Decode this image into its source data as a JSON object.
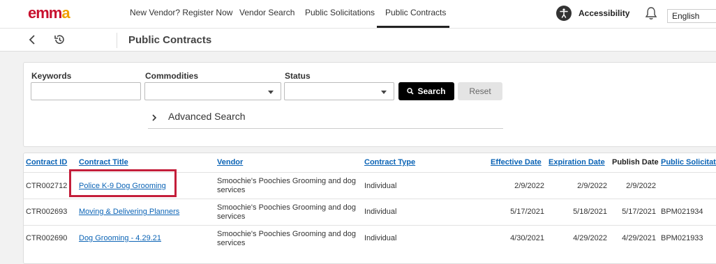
{
  "header": {
    "logo_text": "emma",
    "nav": [
      {
        "label": "New Vendor? Register Now",
        "active": false
      },
      {
        "label": "Vendor Search",
        "active": false
      },
      {
        "label": "Public Solicitations",
        "active": false
      },
      {
        "label": "Public Contracts",
        "active": true
      }
    ],
    "accessibility_label": "Accessibility",
    "language": "English"
  },
  "subheader": {
    "title": "Public Contracts"
  },
  "search": {
    "keywords_label": "Keywords",
    "keywords_value": "",
    "commodities_label": "Commodities",
    "status_label": "Status",
    "search_button": "Search",
    "reset_button": "Reset",
    "advanced_label": "Advanced Search"
  },
  "table": {
    "columns": [
      "Contract ID",
      "Contract Title",
      "Vendor",
      "Contract Type",
      "Effective Date",
      "Expiration Date",
      "Publish Date",
      "Public Solicitati"
    ],
    "rows": [
      {
        "id": "CTR002712",
        "title": "Police K-9 Dog Grooming",
        "vendor": "Smoochie's Poochies Grooming and dog services",
        "type": "Individual",
        "effective": "2/9/2022",
        "expiration": "2/9/2022",
        "publish": "2/9/2022",
        "solicitation": ""
      },
      {
        "id": "CTR002693",
        "title": "Moving & Delivering Planners",
        "vendor": "Smoochie's Poochies Grooming and dog services",
        "type": "Individual",
        "effective": "5/17/2021",
        "expiration": "5/18/2021",
        "publish": "5/17/2021",
        "solicitation": "BPM021934"
      },
      {
        "id": "CTR002690",
        "title": "Dog Grooming - 4.29.21",
        "vendor": "Smoochie's Poochies Grooming and dog services",
        "type": "Individual",
        "effective": "4/30/2021",
        "expiration": "4/29/2022",
        "publish": "4/29/2021",
        "solicitation": "BPM021933"
      }
    ]
  },
  "colors": {
    "brand_red": "#c8102e",
    "brand_orange": "#f0a000",
    "link": "#0a63b5",
    "highlight": "#c41e3a"
  }
}
